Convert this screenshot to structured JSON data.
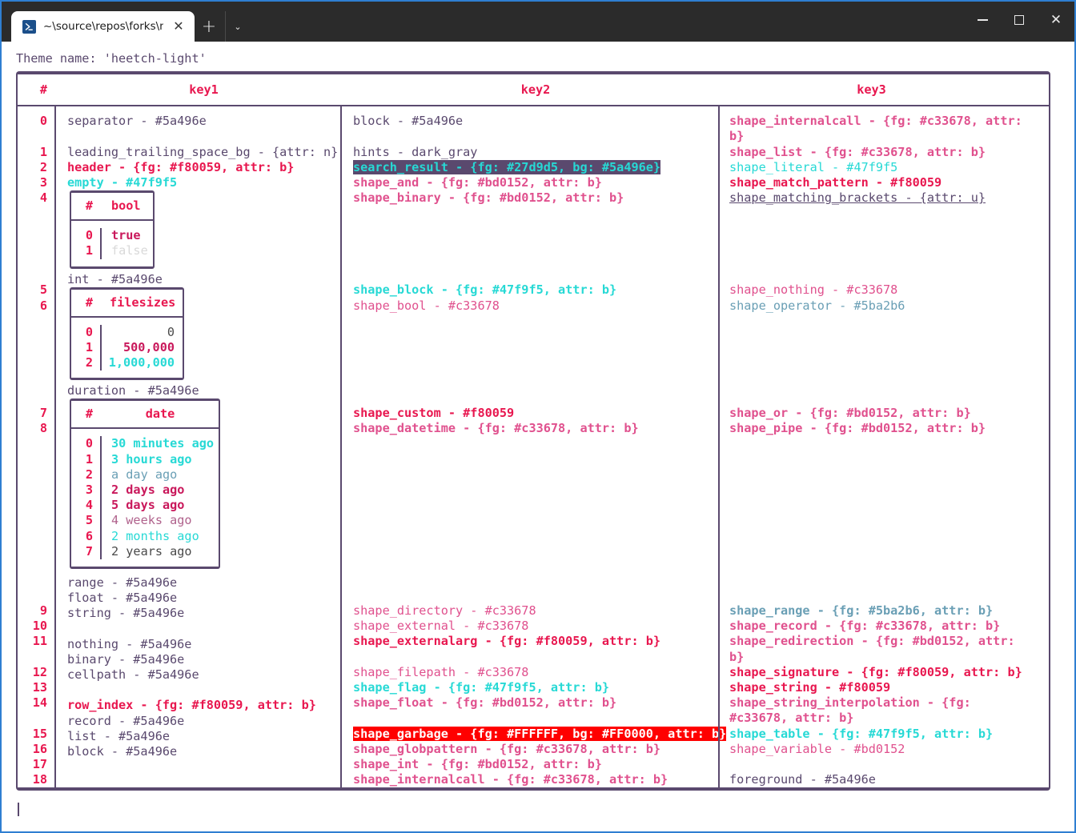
{
  "window": {
    "tab_title": "~\\source\\repos\\forks\\nu_scrip",
    "tab_icon": "powershell-icon",
    "close_label": "✕",
    "new_tab_label": "+",
    "tab_menu_label": "⌄",
    "minimize_label": "minimize",
    "maximize_label": "maximize",
    "close_window_label": "✕",
    "accent_border": "#2f7fd1"
  },
  "terminal": {
    "theme_line": "Theme name: 'heetch-light'",
    "prompt_cursor": "",
    "foreground": "#5a496e",
    "background": "#ffffff",
    "accent_pink": "#e8174f",
    "accent_cyan": "#27d9d5"
  },
  "table": {
    "headers": [
      "#",
      "key1",
      "key2",
      "key3"
    ],
    "row_indices": [
      "0",
      "1",
      "2",
      "3",
      "4",
      "5",
      "6",
      "7",
      "8",
      "9",
      "10",
      "11",
      "12",
      "13",
      "14",
      "15",
      "16",
      "17",
      "18"
    ],
    "key1": [
      "separator - #5a496e",
      "leading_trailing_space_bg - {attr: n}",
      "header - {fg: #f80059, attr: b}",
      "empty - #47f9f5",
      "int - #5a496e",
      "duration - #5a496e",
      "range - #5a496e",
      "float - #5a496e",
      "string - #5a496e",
      "nothing - #5a496e",
      "binary - #5a496e",
      "cellpath - #5a496e",
      "row_index - {fg: #f80059, attr: b}",
      "record - #5a496e",
      "list - #5a496e",
      "block - #5a496e"
    ],
    "key2": [
      "block - #5a496e",
      "hints - dark_gray",
      "search_result - {fg: #27d9d5, bg: #5a496e}",
      "shape_and - {fg: #bd0152, attr: b}",
      "shape_binary - {fg: #bd0152, attr: b}",
      "shape_block - {fg: #47f9f5, attr: b}",
      "shape_bool - #c33678",
      "shape_custom - #f80059",
      "shape_datetime - {fg: #c33678, attr: b}",
      "shape_directory - #c33678",
      "shape_external - #c33678",
      "shape_externalarg - {fg: #f80059, attr: b}",
      "shape_filepath - #c33678",
      "shape_flag - {fg: #47f9f5, attr: b}",
      "shape_float - {fg: #bd0152, attr: b}",
      "shape_garbage - {fg: #FFFFFF, bg: #FF0000, attr: b}",
      "shape_globpattern - {fg: #c33678, attr: b}",
      "shape_int - {fg: #bd0152, attr: b}",
      "shape_internalcall - {fg: #c33678, attr: b}"
    ],
    "key3": [
      "shape_internalcall - {fg: #c33678, attr:",
      "b}",
      "shape_list - {fg: #c33678, attr: b}",
      "shape_literal - #47f9f5",
      "shape_match_pattern - #f80059",
      "shape_matching_brackets - {attr: u}",
      "shape_nothing - #c33678",
      "shape_operator - #5ba2b6",
      "shape_or - {fg: #bd0152, attr: b}",
      "shape_pipe - {fg: #bd0152, attr: b}",
      "shape_range - {fg: #5ba2b6, attr: b}",
      "shape_record - {fg: #c33678, attr: b}",
      "shape_redirection - {fg: #bd0152, attr:",
      "b}",
      "shape_signature - {fg: #f80059, attr: b}",
      "shape_string - #f80059",
      "shape_string_interpolation - {fg:",
      "#c33678, attr: b}",
      "shape_table - {fg: #47f9f5, attr: b}",
      "shape_variable - #bd0152",
      "foreground - #5a496e"
    ]
  },
  "nested_tables": {
    "bool": {
      "headers": [
        "#",
        "bool"
      ],
      "rows": [
        {
          "index": "0",
          "value": "true"
        },
        {
          "index": "1",
          "value": "false"
        }
      ]
    },
    "filesizes": {
      "headers": [
        "#",
        "filesizes"
      ],
      "rows": [
        {
          "index": "0",
          "value": "0"
        },
        {
          "index": "1",
          "value": "500,000"
        },
        {
          "index": "2",
          "value": "1,000,000"
        }
      ]
    },
    "date": {
      "headers": [
        "#",
        "date"
      ],
      "rows": [
        {
          "index": "0",
          "value": "30 minutes ago"
        },
        {
          "index": "1",
          "value": "3 hours ago"
        },
        {
          "index": "2",
          "value": "a day ago"
        },
        {
          "index": "3",
          "value": "2 days ago"
        },
        {
          "index": "4",
          "value": "5 days ago"
        },
        {
          "index": "5",
          "value": "4 weeks ago"
        },
        {
          "index": "6",
          "value": "2 months ago"
        },
        {
          "index": "7",
          "value": "2 years ago"
        }
      ]
    }
  }
}
